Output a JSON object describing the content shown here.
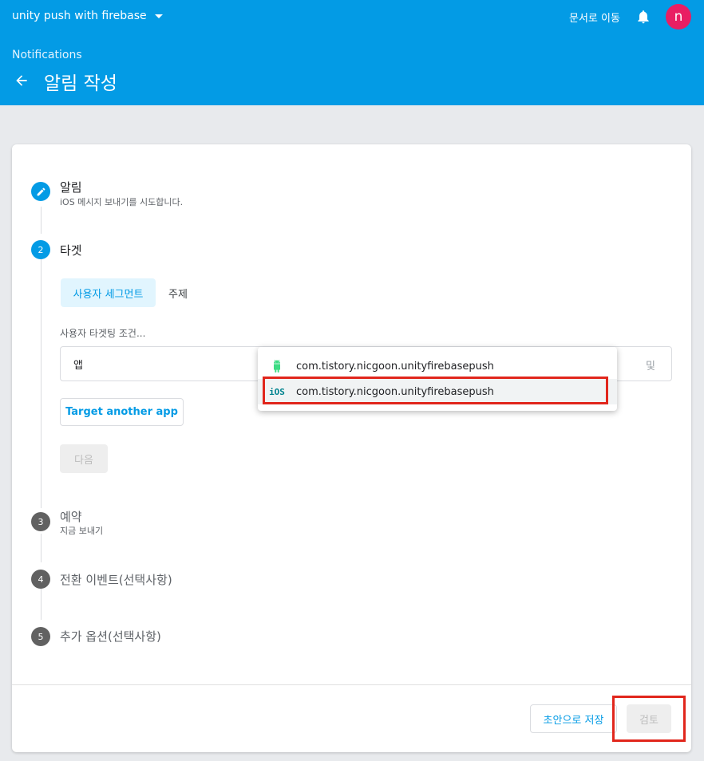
{
  "header": {
    "project_name": "unity push with firebase",
    "docs_link": "문서로 이동",
    "avatar_letter": "n",
    "breadcrumb": "Notifications",
    "title": "알림 작성",
    "background_color": "#039be5"
  },
  "steps": [
    {
      "number": "1",
      "title": "알림",
      "subtitle": "iOS 메시지 보내기를 시도합니다.",
      "state": "done",
      "icon": "pencil-icon"
    },
    {
      "number": "2",
      "title": "타겟",
      "subtitle": "",
      "state": "active"
    },
    {
      "number": "3",
      "title": "예약",
      "subtitle": "지금 보내기",
      "state": "pending"
    },
    {
      "number": "4",
      "title": "전환 이벤트(선택사항)",
      "subtitle": "",
      "state": "pending"
    },
    {
      "number": "5",
      "title": "추가 옵션(선택사항)",
      "subtitle": "",
      "state": "pending"
    }
  ],
  "target": {
    "tabs": [
      {
        "label": "사용자 세그먼트",
        "selected": true
      },
      {
        "label": "주제",
        "selected": false
      }
    ],
    "condition_label": "사용자 타겟팅 조건...",
    "app_label": "앱",
    "and_label": "및",
    "target_another_app": "Target another app",
    "next_button": "다음"
  },
  "app_dropdown": {
    "options": [
      {
        "platform": "android",
        "icon": "android-icon",
        "label": "com.tistory.nicgoon.unityfirebasepush",
        "highlighted": false
      },
      {
        "platform": "ios",
        "icon": "ios-icon",
        "icon_text": "iOS",
        "label": "com.tistory.nicgoon.unityfirebasepush",
        "highlighted": true
      }
    ]
  },
  "footer": {
    "save_draft": "초안으로 저장",
    "review": "검토"
  },
  "colors": {
    "accent": "#039be5",
    "annotation": "#e1261c",
    "avatar": "#e91e63"
  }
}
